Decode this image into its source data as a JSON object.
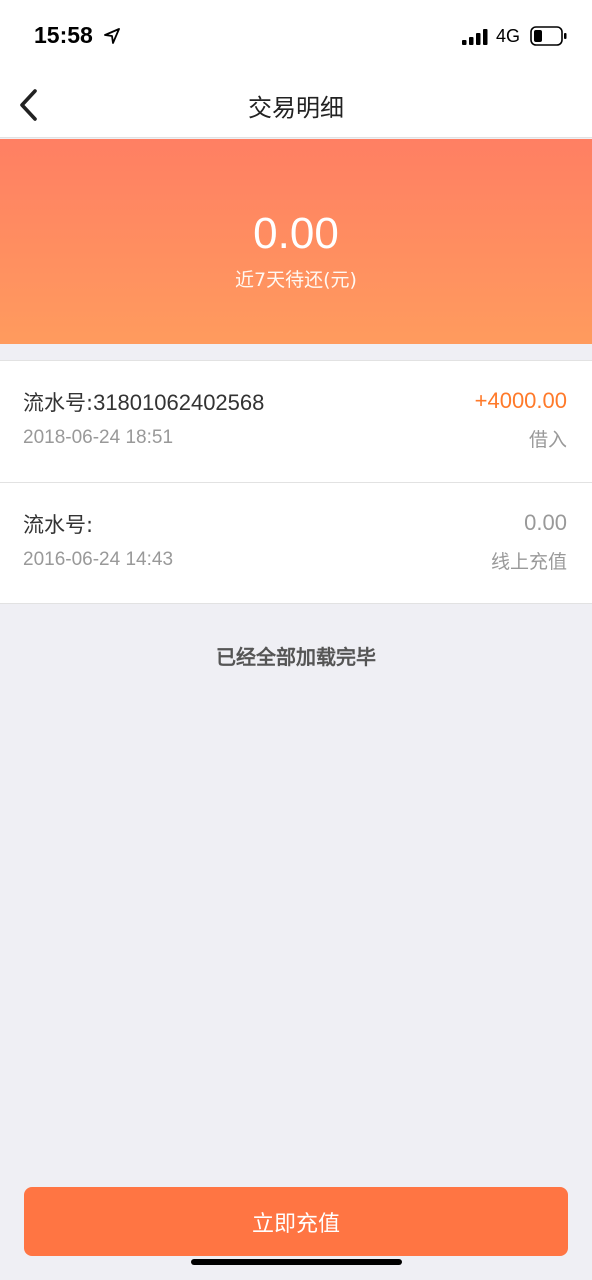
{
  "status_bar": {
    "time": "15:58",
    "network": "4G",
    "icons": [
      "location-arrow-icon",
      "signal-icon",
      "battery-icon"
    ]
  },
  "nav": {
    "title": "交易明细",
    "back_icon": "chevron-left-icon"
  },
  "banner": {
    "amount": "0.00",
    "label": "近7天待还(元)",
    "gradient_colors": [
      "#ff7f63",
      "#ff9b5e"
    ]
  },
  "transactions": [
    {
      "serial_label": "流水号:",
      "serial_value": "31801062402568",
      "time": "2018-06-24 18:51",
      "amount": "+4000.00",
      "type": "借入",
      "amount_color": "#ff7a2a"
    },
    {
      "serial_label": "流水号:",
      "serial_value": "",
      "time": "2016-06-24 14:43",
      "amount": "0.00",
      "type": "线上充值",
      "amount_color": "#999999"
    }
  ],
  "list_footer": "已经全部加载完毕",
  "bottom_button": {
    "label": "立即充值",
    "color": "#ff7543"
  }
}
